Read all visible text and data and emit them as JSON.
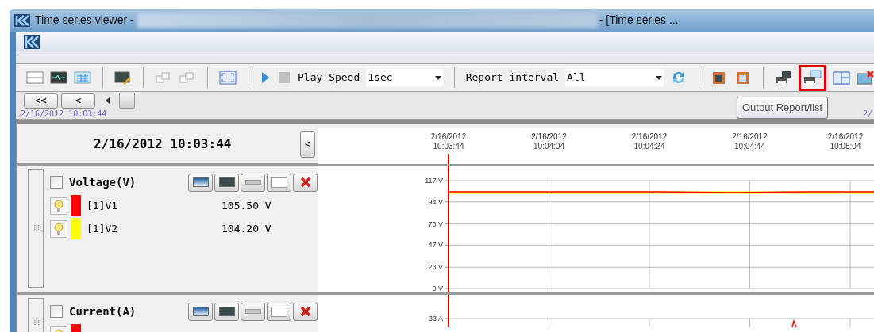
{
  "window": {
    "title": "Time series viewer -",
    "title_suffix": "- [Time series ..."
  },
  "toolbar": {
    "play_speed_label": "Play Speed",
    "play_speed_value": "1sec",
    "report_interval_label": "Report interval",
    "report_interval_value": "All",
    "output_button_highlighted": true
  },
  "tooltip": "Output Report/list",
  "navigator": {
    "buttons": [
      "<<",
      "<"
    ],
    "start_time": "2/16/2012 10:03:44",
    "end_time": "2/"
  },
  "cursor_time": "2/16/2012 10:03:44",
  "back_button": "<",
  "time_axis": [
    {
      "date": "2/16/2012",
      "time": "10:03:44"
    },
    {
      "date": "2/16/2012",
      "time": "10:04:04"
    },
    {
      "date": "2/16/2012",
      "time": "10:04:24"
    },
    {
      "date": "2/16/2012",
      "time": "10:04:44"
    },
    {
      "date": "2/16/2012",
      "time": "10:05:04"
    }
  ],
  "panels": [
    {
      "title": "Voltage(V)",
      "checked": false,
      "channels": [
        {
          "name": "[1]V1",
          "value": "105.50 V",
          "color": "#ff0000"
        },
        {
          "name": "[1]V2",
          "value": "104.20 V",
          "color": "#ffff00"
        }
      ],
      "chart_data": {
        "type": "line",
        "grid": true,
        "categories": [
          null,
          null,
          null,
          null,
          null,
          null,
          null
        ],
        "ylim": [
          0,
          117
        ],
        "yticks": [
          {
            "value": 117,
            "label": "117 V"
          },
          {
            "value": 94,
            "label": "94 V"
          },
          {
            "value": 70,
            "label": "70 V"
          },
          {
            "value": 47,
            "label": "47 V"
          },
          {
            "value": 23,
            "label": "23 V"
          },
          {
            "value": 0,
            "label": "0 V"
          }
        ],
        "series": [
          {
            "color": "#ff0000",
            "values": [
              105,
              105,
              105,
              105,
              104,
              105,
              105
            ]
          },
          {
            "color": "#ffff00",
            "values": [
              104,
              104,
              104,
              104,
              104,
              104,
              104
            ]
          }
        ]
      }
    },
    {
      "title": "Current(A)",
      "checked": false,
      "channels": [
        {
          "color": "#ff0000"
        }
      ],
      "axis_labels": [
        "33 A"
      ]
    }
  ]
}
